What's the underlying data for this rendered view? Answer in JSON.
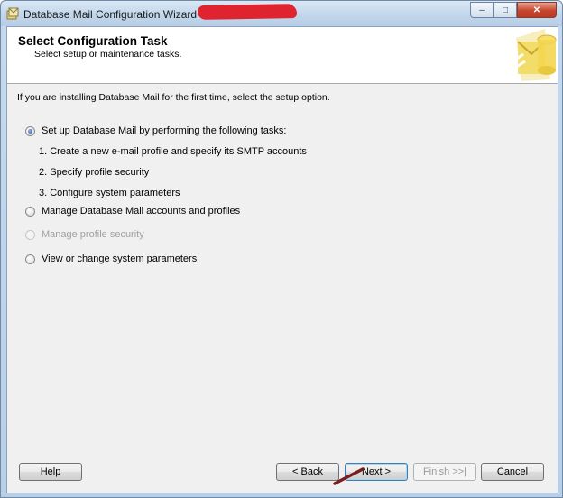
{
  "window": {
    "title": "Database Mail Configuration Wizard -"
  },
  "header": {
    "title": "Select Configuration Task",
    "subtitle": "Select setup or maintenance tasks."
  },
  "intro": "If you are installing Database Mail for the first time, select the setup option.",
  "options": [
    {
      "label": "Set up Database Mail by performing the following tasks:",
      "checked": true,
      "enabled": true
    },
    {
      "label": "Manage Database Mail accounts and profiles",
      "checked": false,
      "enabled": true
    },
    {
      "label": "Manage profile security",
      "checked": false,
      "enabled": false
    },
    {
      "label": "View or change system parameters",
      "checked": false,
      "enabled": true
    }
  ],
  "steps": [
    "1. Create a new e-mail profile and specify its SMTP accounts",
    "2. Specify profile security",
    "3. Configure system parameters"
  ],
  "buttons": {
    "help": "Help",
    "back": "< Back",
    "next": "Next >",
    "finish": "Finish >>|",
    "cancel": "Cancel"
  },
  "caption_buttons": {
    "minimize": "–",
    "maximize": "□",
    "close": "✕"
  },
  "colors": {
    "accent": "#1d4f9c",
    "annotation_arrow": "#7a1f1f",
    "redaction": "#e0242f"
  }
}
